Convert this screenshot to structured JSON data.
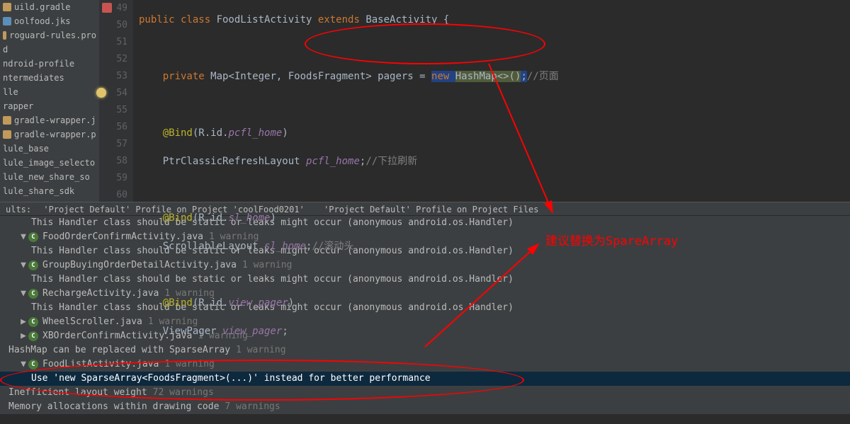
{
  "project_files": [
    {
      "name": "uild.gradle",
      "iconClass": "f"
    },
    {
      "name": "oolfood.jks",
      "iconClass": "k"
    },
    {
      "name": "roguard-rules.pro",
      "iconClass": "f"
    },
    {
      "name": "d",
      "iconClass": ""
    },
    {
      "name": "ndroid-profile",
      "iconClass": ""
    },
    {
      "name": "ntermediates",
      "iconClass": ""
    },
    {
      "name": "lle",
      "iconClass": ""
    },
    {
      "name": "rapper",
      "iconClass": ""
    },
    {
      "name": "gradle-wrapper.j",
      "iconClass": "f"
    },
    {
      "name": "gradle-wrapper.p",
      "iconClass": "f"
    },
    {
      "name": "lule_base",
      "iconClass": ""
    },
    {
      "name": "lule_image_selecto",
      "iconClass": ""
    },
    {
      "name": "lule_new_share_so",
      "iconClass": ""
    },
    {
      "name": "lule_share_sdk",
      "iconClass": ""
    }
  ],
  "code_lines": [
    {
      "n": 49,
      "mark": true
    },
    {
      "n": 50
    },
    {
      "n": 51
    },
    {
      "n": 52
    },
    {
      "n": 53
    },
    {
      "n": 54,
      "bulb": true
    },
    {
      "n": 55
    },
    {
      "n": 56
    },
    {
      "n": 57
    },
    {
      "n": 58
    },
    {
      "n": 59
    },
    {
      "n": 60
    }
  ],
  "code": {
    "l49_kw1": "public class ",
    "l49_cls": "FoodListActivity ",
    "l49_kw2": "extends ",
    "l49_base": "BaseActivity {",
    "l51_kw": "private ",
    "l51_type": "Map<Integer, FoodsFragment> pagers = ",
    "l51_new": "new ",
    "l51_hash": "HashMap<>()",
    "l51_semi": ";",
    "l51_cmt": "//页面",
    "l53_ann": "@Bind",
    "l53_arg_open": "(R.id.",
    "l53_id": "pcfl_home",
    "l53_arg_close": ")",
    "l54_type": "PtrClassicRefreshLayout ",
    "l54_var": "pcfl_home",
    "l54_semi": ";",
    "l54_cmt": "//下拉刷新",
    "l56_ann": "@Bind",
    "l56_arg_open": "(R.id.",
    "l56_id": "sl_home",
    "l56_arg_close": ")",
    "l57_type": "ScrollableLayout ",
    "l57_var": "sl_home",
    "l57_semi": ";",
    "l57_cmt": "//滚动头",
    "l59_ann": "@Bind",
    "l59_arg_open": "(R.id.",
    "l59_id": "view_pager",
    "l59_arg_close": ")",
    "l60_type": "ViewPager ",
    "l60_var": "view_pager",
    "l60_semi": ";"
  },
  "results_header": {
    "label": "ults:",
    "tab1": "'Project Default' Profile on Project 'coolFood0201'",
    "tab2": "'Project Default' Profile on Project Files"
  },
  "results": {
    "handler_msg": "This Handler class should be static or leaks might occur (anonymous android.os.Handler)",
    "r1_name": "FoodOrderConfirmActivity.java",
    "r1_wc": "1 warning",
    "r2_name": "GroupBuyingOrderDetailActivity.java",
    "r2_wc": "1 warning",
    "r3_name": "RechargeActivity.java",
    "r3_wc": "1 warning",
    "r4_name": "WheelScroller.java",
    "r4_wc": "1 warning",
    "r5_name": "XBOrderConfirmActivity.java",
    "r5_wc": "1 warning",
    "r6_name": "HashMap can be replaced with SparseArray",
    "r6_wc": "1 warning",
    "r7_name": "FoodListActivity.java",
    "r7_wc": "1 warning",
    "r7_detail": "Use 'new SparseArray<FoodsFragment>(...)' instead for better performance",
    "r8_name": "Inefficient layout weight",
    "r8_wc": "72 warnings",
    "r9_name": "Memory allocations within drawing code",
    "r9_wc": "7 warnings"
  },
  "annotation": {
    "text": "建议替换为SpareArray"
  }
}
